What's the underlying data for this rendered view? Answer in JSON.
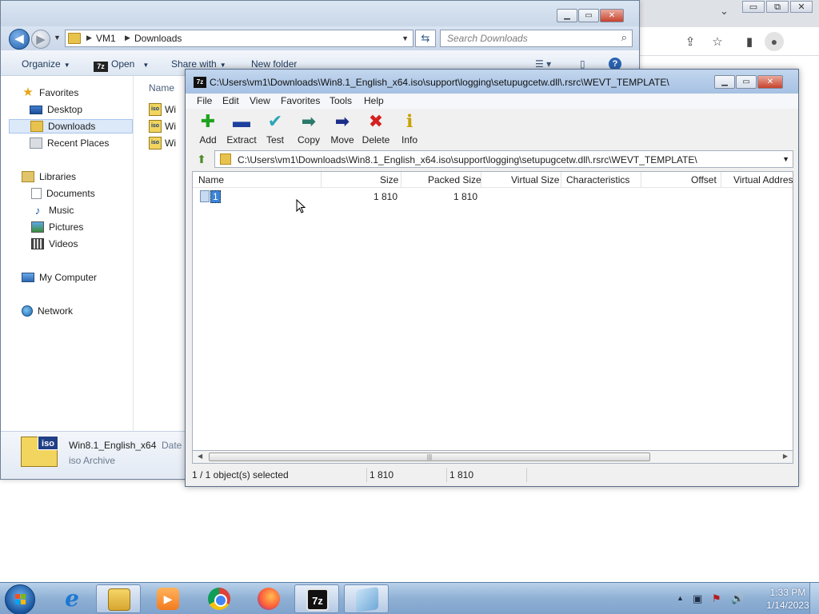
{
  "browser": {
    "chevron": "⌄",
    "min": "▭",
    "restore": "⧉",
    "close": "✕",
    "share_icon": "⇪",
    "star_icon": "☆",
    "panel_icon": "▮",
    "avatar_icon": "●"
  },
  "explorer": {
    "breadcrumb": [
      "VM1",
      "Downloads"
    ],
    "search_placeholder": "Search Downloads",
    "toolbar": {
      "organize": "Organize",
      "open": "Open",
      "open_icon": "7z",
      "share_with": "Share with",
      "new_folder": "New folder"
    },
    "sidebar": {
      "favorites": "Favorites",
      "desktop": "Desktop",
      "downloads": "Downloads",
      "recent_places": "Recent Places",
      "libraries": "Libraries",
      "documents": "Documents",
      "music": "Music",
      "pictures": "Pictures",
      "videos": "Videos",
      "my_computer": "My Computer",
      "network": "Network"
    },
    "column_name": "Name",
    "file_rows": [
      "Wi",
      "Wi",
      "Wi"
    ],
    "file_icon": "iso",
    "details": {
      "name": "Win8.1_English_x64",
      "date_label": "Date",
      "type": "iso Archive",
      "icon_tag": "iso"
    }
  },
  "sevenzip": {
    "title_icon": "7z",
    "title": "C:\\Users\\vm1\\Downloads\\Win8.1_English_x64.iso\\support\\logging\\setupugcetw.dll\\.rsrc\\WEVT_TEMPLATE\\",
    "menu": [
      "File",
      "Edit",
      "View",
      "Favorites",
      "Tools",
      "Help"
    ],
    "tools": [
      {
        "label": "Add",
        "glyph": "✚",
        "color": "#1fa31f"
      },
      {
        "label": "Extract",
        "glyph": "▬",
        "color": "#1d3f9e"
      },
      {
        "label": "Test",
        "glyph": "✔",
        "color": "#2aa6b8"
      },
      {
        "label": "Copy",
        "glyph": "➡",
        "color": "#2a7a6a"
      },
      {
        "label": "Move",
        "glyph": "➡",
        "color": "#1b2f8a"
      },
      {
        "label": "Delete",
        "glyph": "✖",
        "color": "#d42020"
      },
      {
        "label": "Info",
        "glyph": "ℹ",
        "color": "#c9a100"
      }
    ],
    "path": "C:\\Users\\vm1\\Downloads\\Win8.1_English_x64.iso\\support\\logging\\setupugcetw.dll\\.rsrc\\WEVT_TEMPLATE\\",
    "columns": [
      "Name",
      "Size",
      "Packed Size",
      "Virtual Size",
      "Characteristics",
      "Offset",
      "Virtual Addres"
    ],
    "rows": [
      {
        "name": "1",
        "size": "1 810",
        "packed_size": "1 810"
      }
    ],
    "status": {
      "selected": "1 / 1 object(s) selected",
      "size": "1 810",
      "packed": "1 810"
    }
  },
  "taskbar": {
    "sevenzip_label": "7z",
    "ie_label": "e",
    "clock_time": "1:33 PM",
    "clock_date": "1/14/2023",
    "tray_icons": [
      "▲",
      "▣",
      "⚑",
      "🔊"
    ]
  }
}
